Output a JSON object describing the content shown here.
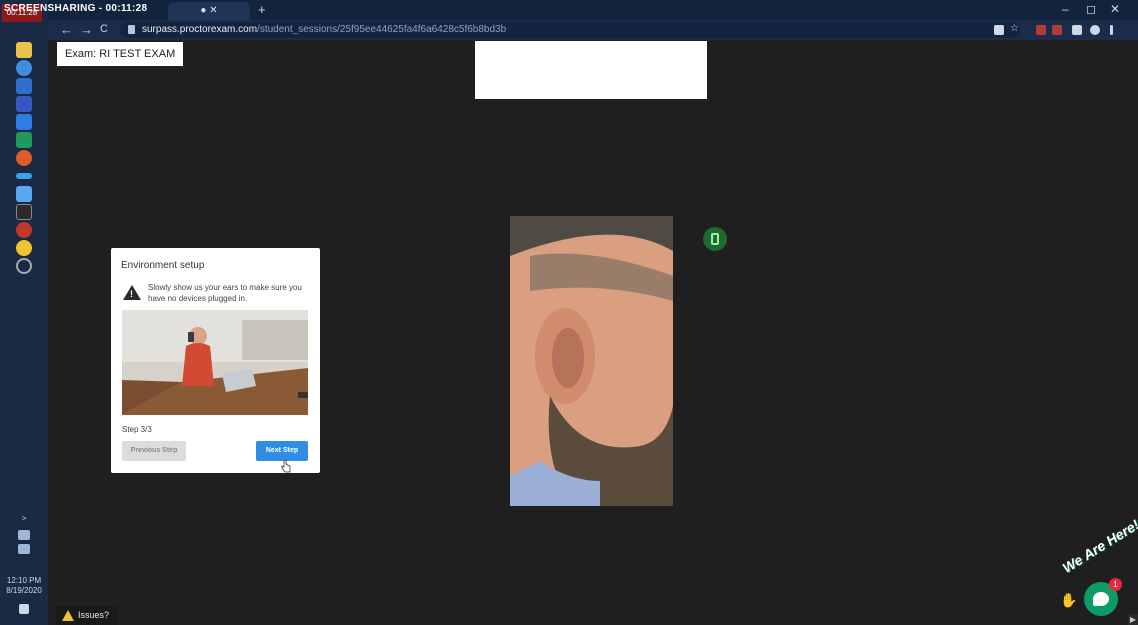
{
  "screen_sharing": {
    "label": "SCREENSHARING",
    "timer": "00:11:28",
    "badge_time": "00:11:28"
  },
  "browser": {
    "tab_label": "● ✕",
    "new_tab": "+",
    "url_host": "surpass.proctorexam.com",
    "url_path": "/student_sessions/25f95ee44625fa4f6a6428c5f6b8bd3b",
    "nav_back": "←",
    "nav_forward": "→",
    "nav_reload": "C",
    "minimize": "–",
    "restore": "◻",
    "close": "✕"
  },
  "exam": {
    "label": "Exam: RI TEST EXAM"
  },
  "steps": [
    {
      "icon": "id-card-icon"
    },
    {
      "icon": "phone-check-icon"
    },
    {
      "icon": "phone-camera-icon",
      "active": true
    },
    {
      "icon": "webcam-icon"
    }
  ],
  "setup_card": {
    "title": "Environment setup",
    "instruction": "Slowly show us your ears to make sure you have no devices plugged in.",
    "step_text": "Step 3/3",
    "previous_label": "Previous Step",
    "next_label": "Next Step"
  },
  "issues": {
    "label": "Issues?"
  },
  "chat": {
    "label": "We Are Here!",
    "badge": "1"
  },
  "system_tray": {
    "time": "12:10 PM",
    "date": "8/19/2020"
  },
  "colors": {
    "background": "#1f1f1f",
    "accent_blue": "#2f8de4",
    "phone_green": "#1e6b2d",
    "chat_green": "#0d9c66"
  }
}
